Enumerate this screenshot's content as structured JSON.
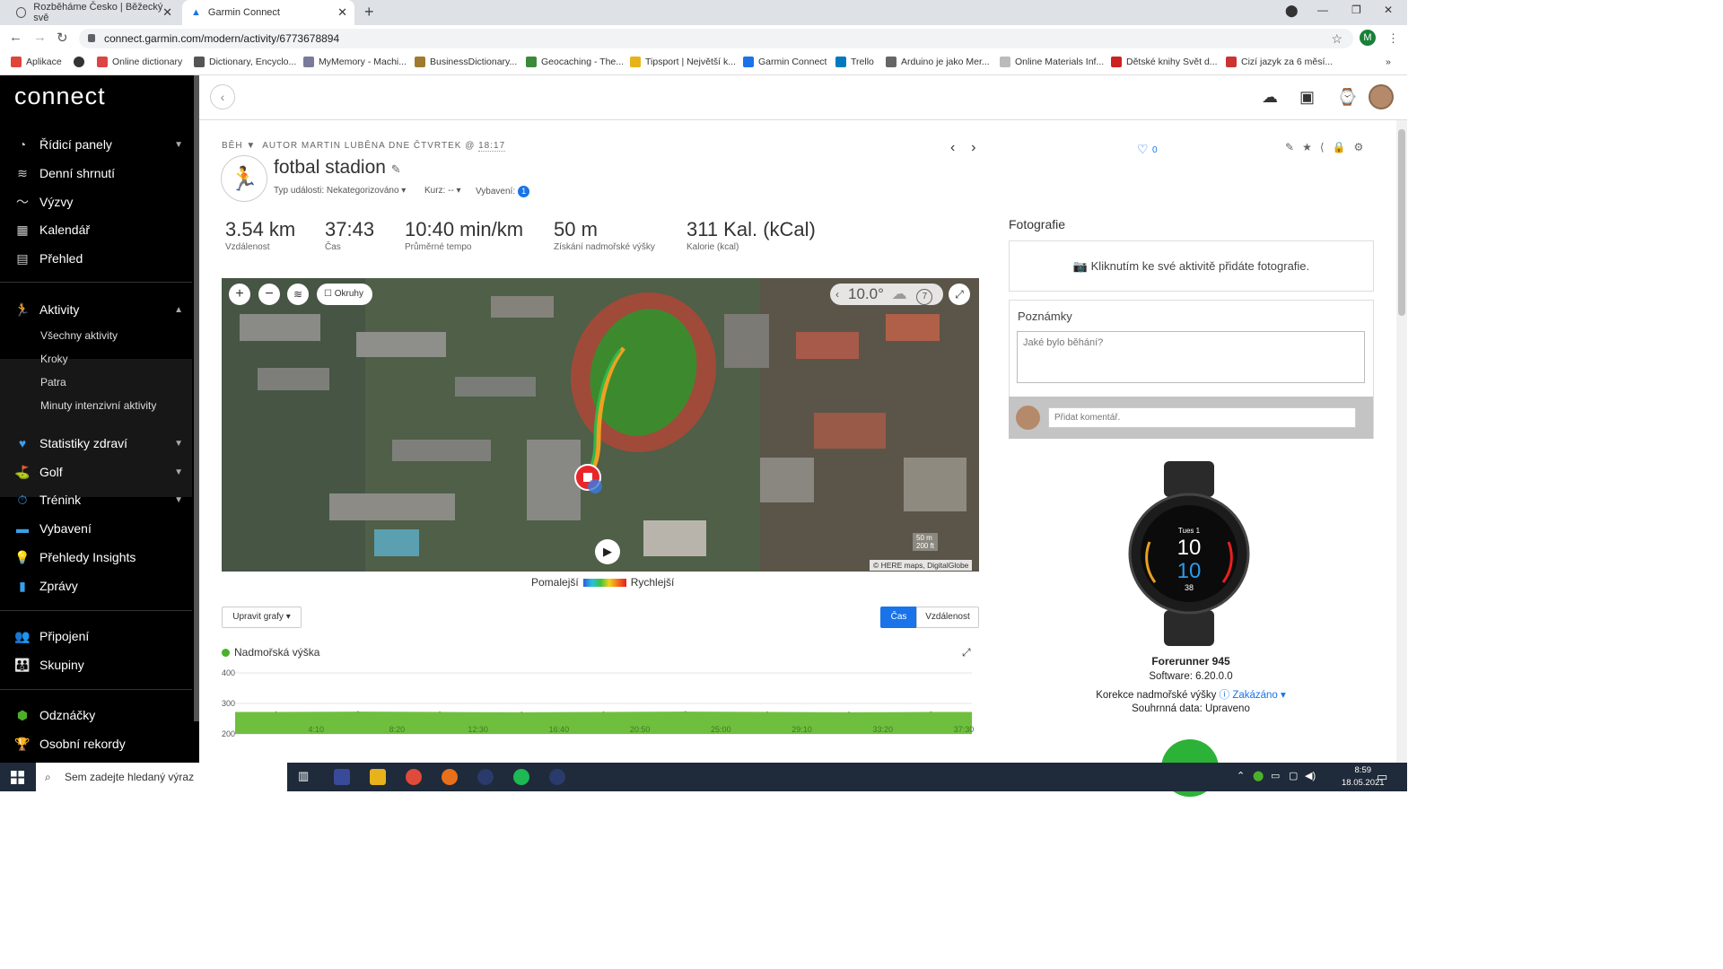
{
  "browser": {
    "tabs": [
      {
        "title": "Rozběháme Česko | Běžecký svě"
      },
      {
        "title": "Garmin Connect"
      }
    ],
    "url": "connect.garmin.com/modern/activity/6773678894",
    "profile_initial": "M",
    "bookmarks": [
      "Aplikace",
      "Online dictionary",
      "Dictionary, Encyclo...",
      "MyMemory - Machi...",
      "BusinessDictionary...",
      "Geocaching - The...",
      "Tipsport | Největší k...",
      "Garmin Connect",
      "Trello",
      "Arduino je jako Mer...",
      "Online Materials Inf...",
      "Dětské knihy Svět d...",
      "Cizí jazyk za 6 měsí..."
    ]
  },
  "sidebar": {
    "logo": "connect",
    "items": [
      {
        "label": "Řídicí panely",
        "icon": "gauge-icon"
      },
      {
        "label": "Denní shrnutí",
        "icon": "layers-icon"
      },
      {
        "label": "Výzvy",
        "icon": "trend-icon"
      },
      {
        "label": "Kalendář",
        "icon": "calendar-icon"
      },
      {
        "label": "Přehled",
        "icon": "newsfeed-icon"
      },
      {
        "label": "Aktivity",
        "icon": "running-icon"
      },
      {
        "label": "Statistiky zdraví",
        "icon": "heart-icon"
      },
      {
        "label": "Golf",
        "icon": "golf-icon"
      },
      {
        "label": "Trénink",
        "icon": "stopwatch-icon"
      },
      {
        "label": "Vybavení",
        "icon": "shoe-icon"
      },
      {
        "label": "Přehledy Insights",
        "icon": "bulb-icon"
      },
      {
        "label": "Zprávy",
        "icon": "bar-chart-icon"
      },
      {
        "label": "Připojení",
        "icon": "people-icon"
      },
      {
        "label": "Skupiny",
        "icon": "group-icon"
      },
      {
        "label": "Odznáčky",
        "icon": "badge-icon"
      },
      {
        "label": "Osobní rekordy",
        "icon": "trophy-icon"
      }
    ],
    "activity_subitems": [
      "Všechny aktivity",
      "Kroky",
      "Patra",
      "Minuty intenzivní aktivity"
    ]
  },
  "activity": {
    "type": "BĚH",
    "byline": "AUTOR MARTIN LUBĚNA DNE ČTVRTEK @",
    "time": "18:17",
    "title": "fotbal stadion",
    "event_type": "Typ události: Nekategorizováno",
    "course": "Kurz: --",
    "equipment": "Vybavení:",
    "equipment_count": "1",
    "likes": "0"
  },
  "stats": [
    {
      "value": "3.54 km",
      "label": "Vzdálenost"
    },
    {
      "value": "37:43",
      "label": "Čas"
    },
    {
      "value": "10:40 min/km",
      "label": "Průměrné tempo"
    },
    {
      "value": "50 m",
      "label": "Získání nadmořské výšky"
    },
    {
      "value": "311 Kal. (kCal)",
      "label": "Kalorie (kcal)"
    }
  ],
  "map": {
    "laps_label": "Okruhy",
    "temperature": "10.0°",
    "wind": "7",
    "scale_m": "50 m",
    "scale_ft": "200 ft",
    "attribution": "© HERE maps, DigitalGlobe",
    "legend_slow": "Pomalejší",
    "legend_fast": "Rychlejší"
  },
  "charts_controls": {
    "edit_graphs": "Upravit grafy ▾",
    "toggle_time": "Čas",
    "toggle_distance": "Vzdálenost"
  },
  "chart_data": {
    "type": "area",
    "title": "Nadmořská výška",
    "x": [
      "4:10",
      "8:20",
      "12:30",
      "16:40",
      "20:50",
      "25:00",
      "29:10",
      "33:20",
      "37:30"
    ],
    "values": [
      272,
      273,
      272,
      271,
      272,
      273,
      272,
      271,
      272
    ],
    "yticks": [
      400,
      300,
      200
    ],
    "ylim": [
      200,
      400
    ],
    "color": "#6fbf3f"
  },
  "right_panel": {
    "photos_heading": "Fotografie",
    "photos_cta": "Kliknutím ke své aktivitě přidáte fotografie.",
    "notes_heading": "Poznámky",
    "notes_placeholder": "Jaké bylo běhání?",
    "comment_placeholder": "Přidat komentář.",
    "device_name": "Forerunner 945",
    "software": "Software: 6.20.0.0",
    "elevation_correction_label": "Korekce nadmořské výšky",
    "elevation_correction_value": "Zakázáno",
    "summary_data": "Souhrnná data: Upraveno",
    "watch_face": {
      "day": "Tues 1",
      "hour": "10",
      "minute": "10",
      "value": "38"
    }
  },
  "taskbar": {
    "search_placeholder": "Sem zadejte hledaný výraz",
    "time": "8:59",
    "date": "18.05.2021"
  }
}
